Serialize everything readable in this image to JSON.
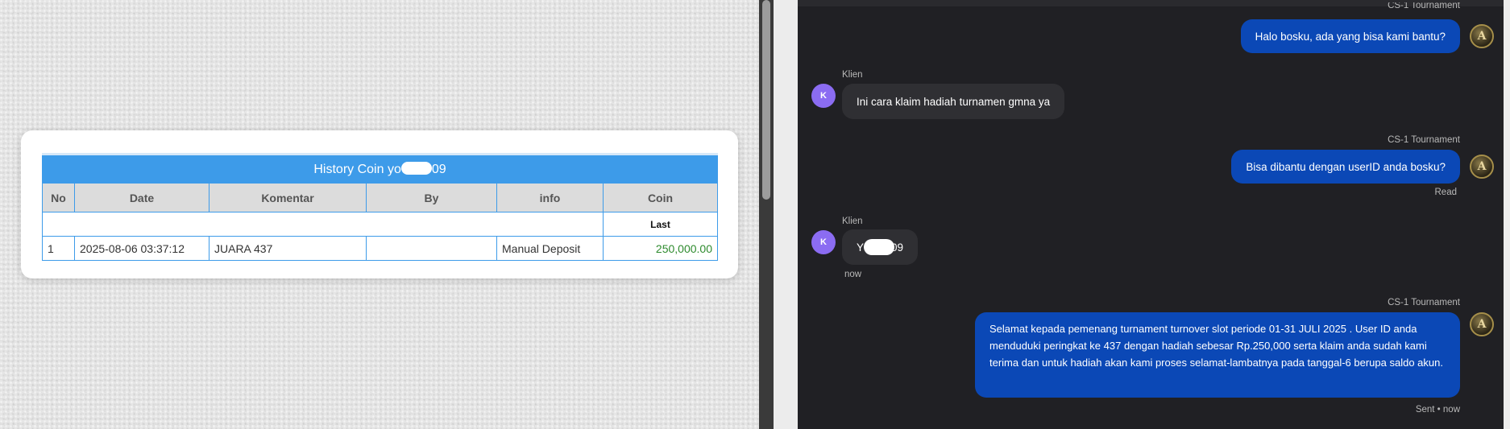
{
  "history": {
    "title_prefix": "History Coin yo",
    "title_suffix": "09",
    "headers": [
      "No",
      "Date",
      "Komentar",
      "By",
      "info",
      "Coin"
    ],
    "last_label": "Last",
    "rows": [
      {
        "no": "1",
        "date": "2025-08-06 03:37:12",
        "komentar": "JUARA 437",
        "by": "",
        "info": "Manual Deposit",
        "coin": "250,000.00"
      }
    ]
  },
  "chat": {
    "partial_top_label": "CS-1 Tournament",
    "messages": [
      {
        "from": "agent",
        "text": "Halo bosku, ada yang bisa kami bantu?"
      },
      {
        "from": "client",
        "sender": "Klien",
        "avatar": "K",
        "text": "Ini cara klaim hadiah turnamen gmna ya"
      },
      {
        "from": "agent",
        "sender": "CS-1 Tournament",
        "text": "Bisa dibantu dengan userID anda bosku?",
        "status": "Read"
      },
      {
        "from": "client",
        "sender": "Klien",
        "avatar": "K",
        "text_prefix": "Y",
        "text_suffix": "09",
        "time": "now"
      },
      {
        "from": "agent",
        "sender": "CS-1 Tournament",
        "text": "Selamat kepada pemenang turnament turnover slot periode 01-31 JULI 2025 . User ID anda menduduki peringkat ke 437 dengan hadiah sebesar Rp.250,000 serta klaim anda sudah kami terima dan untuk hadiah akan kami proses selamat-lambatnya pada tanggal-6 berupa saldo akun.",
        "status": "Sent • now"
      }
    ],
    "agent_avatar_letter": "A"
  },
  "colors": {
    "table_accent": "#3d9be9",
    "agent_bubble": "#0b48b6",
    "client_bubble": "#2f2f33",
    "client_avatar": "#8b6cf2",
    "coin_value": "#2e8b2e"
  }
}
